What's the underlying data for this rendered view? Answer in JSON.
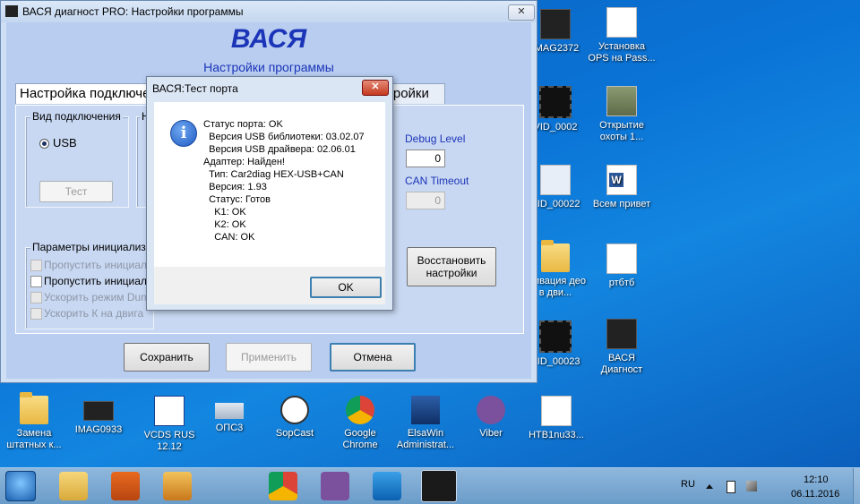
{
  "main_window": {
    "title": "ВАСЯ диагност PRO:  Настройки программы",
    "close_glyph": "✕",
    "app_title": "ВАСЯ",
    "subtitle": "Настройки программы",
    "tabs": [
      "Настройка подключе",
      "тройки"
    ],
    "connection_group": {
      "label": "Вид подключения",
      "radio_label": "USB",
      "test_button": "Тест",
      "second_group_letter": "Н"
    },
    "debug": {
      "debug_label": "Debug Level",
      "debug_value": "0",
      "can_label": "CAN Timeout",
      "can_value": "0"
    },
    "init_group": {
      "label": "Параметры инициализа",
      "options": [
        {
          "label": "Пропустить инициал",
          "enabled": false
        },
        {
          "label": "Пропустить инициал",
          "enabled": true
        },
        {
          "label": "Ускорить режим Dum",
          "enabled": false
        },
        {
          "label": "Ускорить К на двига",
          "enabled": false
        }
      ]
    },
    "restore_button": [
      "Восстановить",
      "настройки"
    ],
    "buttons": {
      "save": "Сохранить",
      "apply": "Применить",
      "cancel": "Отмена"
    }
  },
  "dialog": {
    "title": "ВАСЯ:Тест порта",
    "close_glyph": "✕",
    "info_glyph": "i",
    "lines": [
      "Статус порта: OK",
      "  Версия USB библиотеки: 03.02.07",
      "  Версия USB драйвера: 02.06.01",
      "Адаптер: Найден!",
      "  Тип: Car2diag HEX-USB+CAN",
      "  Версия: 1.93",
      "  Статус: Готов",
      "    K1: OK",
      "    K2: OK",
      "    CAN: OK"
    ],
    "ok_button": "OK"
  },
  "desktop": {
    "right_icons": [
      {
        "label": "IMAG2372",
        "icon": "video-thumbnail-icon"
      },
      {
        "label": "Установка OPS на Pass...",
        "icon": "document-icon"
      },
      {
        "label": "VID_0002",
        "icon": "video-file-icon"
      },
      {
        "label": "Открытие охоты 1...",
        "icon": "image-file-icon"
      },
      {
        "label": "VID_00022",
        "icon": "media-file-icon"
      },
      {
        "label": "Всем привет",
        "icon": "word-document-icon"
      },
      {
        "label": "ктивация део в дви...",
        "icon": "folder-icon"
      },
      {
        "label": "ртбтб",
        "icon": "text-document-icon"
      },
      {
        "label": "VID_00023",
        "icon": "video-file-icon"
      },
      {
        "label": "ВАСЯ Диагност",
        "icon": "vasya-app-icon"
      }
    ],
    "bottom_icons": [
      {
        "label": "Замена штатных к...",
        "icon": "folder-icon"
      },
      {
        "label": "IMAG0933",
        "icon": "image-thumbnail-icon"
      },
      {
        "label": "VCDS RUS 12.12",
        "icon": "vcds-icon"
      },
      {
        "label": "ОПС3",
        "icon": "card-icon"
      },
      {
        "label": "SopCast",
        "icon": "sopcast-icon"
      },
      {
        "label": "Google Chrome",
        "icon": "chrome-icon"
      },
      {
        "label": "ElsaWin Administrat...",
        "icon": "elsawin-icon"
      },
      {
        "label": "Viber",
        "icon": "viber-icon"
      },
      {
        "label": "HTB1nu33...",
        "icon": "image-file-icon"
      }
    ]
  },
  "taskbar": {
    "items": [
      "start-orb-icon",
      "explorer-icon",
      "media-player-icon",
      "paint-icon",
      "chrome-icon",
      "viber-icon",
      "teamviewer-icon",
      "vasya-app-icon"
    ],
    "language": "RU",
    "time": "12:10",
    "date": "06.11.2016"
  },
  "colors": {
    "title_blue": "#1c34b8",
    "desktop_blue": "#0a74d6"
  }
}
